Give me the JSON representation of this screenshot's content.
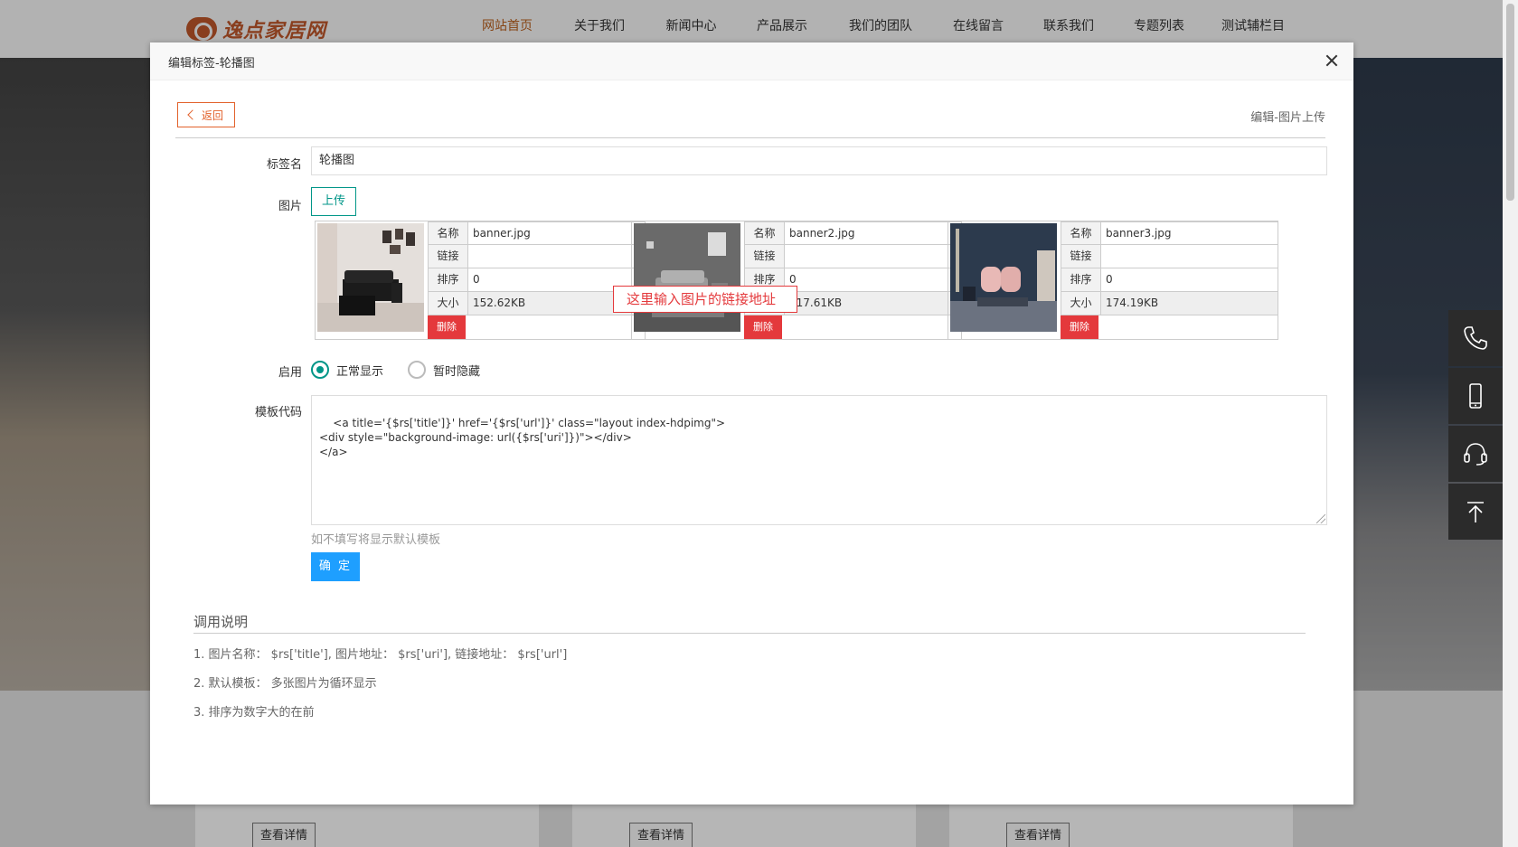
{
  "site": {
    "logo_text": "逸点家居网",
    "nav": [
      "网站首页",
      "关于我们",
      "新闻中心",
      "产品展示",
      "我们的团队",
      "在线留言",
      "联系我们",
      "专题列表",
      "测试辅栏目"
    ],
    "nav_active_index": 0,
    "detail_buttons": [
      "查看详情",
      "查看详情",
      "查看详情"
    ]
  },
  "side_tools": [
    {
      "icon": "phone-icon"
    },
    {
      "icon": "mobile-icon"
    },
    {
      "icon": "headset-icon"
    },
    {
      "icon": "back-to-top-icon"
    }
  ],
  "modal": {
    "title": "编辑标签-轮播图",
    "back_label": "返回",
    "breadcrumb": "编辑-图片上传",
    "name_label": "标签名",
    "name_value": "轮播图",
    "image_label": "图片",
    "upload_label": "上传",
    "images": [
      {
        "name_key": "名称",
        "name": "banner.jpg",
        "link_key": "链接",
        "link": "",
        "order_key": "排序",
        "order": "0",
        "size_key": "大小",
        "size": "152.62KB",
        "delete_label": "删除"
      },
      {
        "name_key": "名称",
        "name": "banner2.jpg",
        "link_key": "链接",
        "link": "",
        "order_key": "排序",
        "order": "0",
        "size_key": "大小",
        "size": "217.61KB",
        "delete_label": "删除"
      },
      {
        "name_key": "名称",
        "name": "banner3.jpg",
        "link_key": "链接",
        "link": "",
        "order_key": "排序",
        "order": "0",
        "size_key": "大小",
        "size": "174.19KB",
        "delete_label": "删除"
      }
    ],
    "tooltip": "这里输入图片的链接地址",
    "enable_label": "启用",
    "radio_options": [
      "正常显示",
      "暂时隐藏"
    ],
    "radio_selected": 0,
    "template_label": "模板代码",
    "template_code": "<a title='{$rs['title']}' href='{$rs['url']}' class=\"layout index-hdpimg\">\n<div style=\"background-image: url({$rs['uri']})\"></div>\n</a>",
    "template_hint": "如不填写将显示默认模板",
    "confirm_label": "确 定",
    "notes_title": "调用说明",
    "notes": [
      "1. 图片名称： $rs['title'], 图片地址： $rs['uri'], 链接地址： $rs['url']",
      "2. 默认模板： 多张图片为循环显示",
      "3. 排序为数字大的在前"
    ]
  },
  "colors": {
    "accent_teal": "#009688",
    "accent_blue": "#1e9fff",
    "danger_red": "#e4393c",
    "back_orange": "#e2622c"
  }
}
